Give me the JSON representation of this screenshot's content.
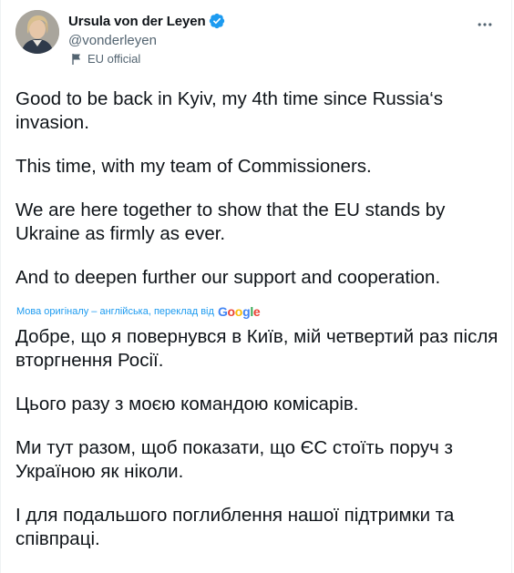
{
  "author": {
    "name": "Ursula von der Leyen",
    "handle": "@vonderleyen",
    "label": "EU official"
  },
  "icons": {
    "verified": "verified-badge-icon",
    "label_flag": "flag-icon",
    "more": "more-dots-icon"
  },
  "colors": {
    "verified": "#1d9bf0",
    "link": "#1d9bf0",
    "secondary_text": "#536471",
    "text": "#0f1419"
  },
  "tweet": {
    "paragraphs": [
      "Good to be back in Kyiv, my 4th time since Russia‘s invasion.",
      "This time, with my team of Commissioners.",
      "We are here together to show that the EU stands by Ukraine as firmly as ever.",
      "And to deepen further our support and cooperation."
    ]
  },
  "translation": {
    "note": "Мова оригіналу – англійська, переклад від",
    "provider": "Google",
    "paragraphs": [
      "Добре, що я повернувся в Київ, мій четвертий раз після вторгнення Росії.",
      "Цього разу з моєю командою комісарів.",
      "Ми тут разом, щоб показати, що ЄС стоїть поруч з Україною як ніколи.",
      "І для подальшого поглиблення нашої підтримки та співпраці."
    ]
  }
}
